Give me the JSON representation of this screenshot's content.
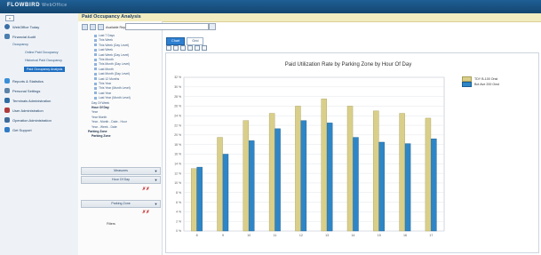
{
  "app": {
    "brand": "FLOWBIRD",
    "brand_sub": "WebOffice"
  },
  "sidebar": {
    "collapse_label": "«",
    "items": [
      {
        "label": "WebOffice Today",
        "icon": "home-icon",
        "color": "#3a6ea5"
      },
      {
        "label": "Financial Audit",
        "icon": "audit-icon",
        "color": "#4a7fb0"
      },
      {
        "label": "Reports & Statistics",
        "icon": "reports-icon",
        "color": "#3a8fd9"
      },
      {
        "label": "Personal Settings",
        "icon": "settings-icon",
        "color": "#5d84a9"
      },
      {
        "label": "Terminals Administration",
        "icon": "terminal-icon",
        "color": "#2f6ca4"
      },
      {
        "label": "User Administration",
        "icon": "users-icon",
        "color": "#b03a3a"
      },
      {
        "label": "Operation Administration",
        "icon": "operation-icon",
        "color": "#3d6b9a"
      },
      {
        "label": "Get Support",
        "icon": "support-icon",
        "color": "#2f7bc6"
      }
    ],
    "occupancy": {
      "group_label": "Occupancy",
      "items": [
        "Online Paid Occupancy",
        "Historical Paid Occupancy",
        "Paid Occupancy Analysis"
      ],
      "active_index": 2
    }
  },
  "panel": {
    "title": "Paid Occupancy Analysis"
  },
  "tree_toolbar": {
    "available_reports_label": "Available Reports"
  },
  "tree": {
    "time_nodes": [
      "Last 7 Days",
      "This Week",
      "This Week (Day Level)",
      "Last Week",
      "Last Week (Day Level)",
      "This Month",
      "This Month (Day Level)",
      "Last Month",
      "Last Month (Day Level)",
      "Last 12 Months",
      "This Year",
      "This Year (Month Level)",
      "Last Year",
      "Last Year (Month Level)"
    ],
    "other_nodes": [
      "Day Of Week",
      "Hour Of Day",
      "Year",
      "Year Month",
      "Year - Month - Date - Hour",
      "Year - Week - Date"
    ],
    "bold_other": [
      "Hour Of Day"
    ],
    "parking_zone": "Parking Zone",
    "parking_zone_child": "Parking Zone"
  },
  "filters": {
    "measures": "Measures",
    "hour_of_day": "Hour Of Day",
    "parking_zone": "Parking Zone",
    "filters_label": "Filters"
  },
  "tabs": {
    "chart": "Chart",
    "grid": "Grid"
  },
  "chart_data": {
    "type": "bar",
    "title": "Paid Utilization Rate by Parking Zone by Hour Of Day",
    "categories": [
      "8",
      "9",
      "10",
      "11",
      "12",
      "13",
      "14",
      "15",
      "16",
      "17"
    ],
    "ylim": [
      0,
      32
    ],
    "ytick_step": 2,
    "series": [
      {
        "name": "TDY B-100 Onst",
        "color": "#d9cf8a",
        "values": [
          13,
          19.5,
          23,
          24.5,
          26,
          27.5,
          26,
          25,
          24.5,
          23.5
        ]
      },
      {
        "name": "Bot Ave 200 Onst",
        "color": "#2f86c6",
        "values": [
          13.3,
          16,
          18.8,
          21.3,
          23,
          22.5,
          19.5,
          18.5,
          18.2,
          19.2
        ]
      }
    ]
  }
}
